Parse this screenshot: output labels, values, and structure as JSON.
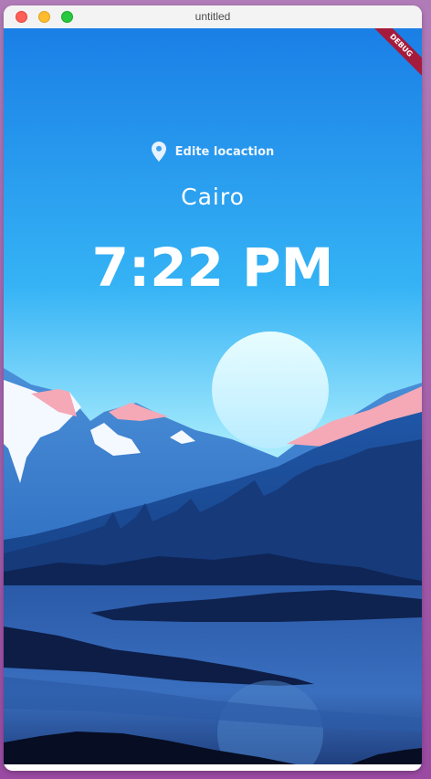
{
  "window": {
    "title": "untitled"
  },
  "location": {
    "button_label": "Edite locaction",
    "icon": "location-pin-icon"
  },
  "city": "Cairo",
  "time": "7:22 PM",
  "debug_banner": "DEBUG",
  "colors": {
    "sky_top": "#1a7fe6",
    "sky_bottom": "#bdf4ff",
    "sun": "#e3fbff",
    "mountain_snow_pink": "#f5a8b6",
    "debug_banner": "#a51b3c"
  }
}
